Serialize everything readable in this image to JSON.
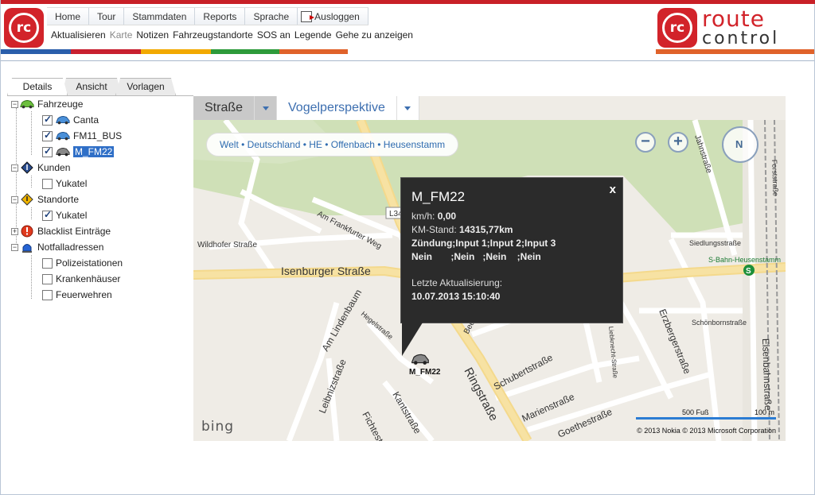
{
  "header": {
    "menu": [
      "Home",
      "Tour",
      "Stammdaten",
      "Reports",
      "Sprache",
      "Ausloggen"
    ],
    "toolbar": [
      "Aktualisieren",
      "Karte",
      "Notizen",
      "Fahrzeugstandorte",
      "SOS an",
      "Legende",
      "Gehe zu anzeigen"
    ],
    "logo_text_line1": "route",
    "logo_text_line2": "control",
    "logo_mark": "rc"
  },
  "left_panel": {
    "tabs": [
      "Details",
      "Ansicht",
      "Vorlagen"
    ],
    "tree": [
      {
        "label": "Fahrzeuge",
        "icon": "car-icon",
        "expanded": true,
        "children": [
          {
            "label": "Canta",
            "checked": true,
            "icon": "car-icon"
          },
          {
            "label": "FM11_BUS",
            "checked": true,
            "icon": "car-icon"
          },
          {
            "label": "M_FM22",
            "checked": true,
            "icon": "car-icon",
            "selected": true
          }
        ]
      },
      {
        "label": "Kunden",
        "icon": "diamond-icon",
        "expanded": true,
        "children": [
          {
            "label": "Yukatel",
            "checked": false
          }
        ]
      },
      {
        "label": "Standorte",
        "icon": "warning-diamond-icon",
        "expanded": true,
        "children": [
          {
            "label": "Yukatel",
            "checked": true
          }
        ]
      },
      {
        "label": "Blacklist Einträge",
        "icon": "alert-icon",
        "expanded": false,
        "children": []
      },
      {
        "label": "Notfalladressen",
        "icon": "siren-icon",
        "expanded": true,
        "children": [
          {
            "label": "Polizeistationen",
            "checked": false
          },
          {
            "label": "Krankenhäuser",
            "checked": false
          },
          {
            "label": "Feuerwehren",
            "checked": false
          }
        ]
      }
    ]
  },
  "map": {
    "tabs": [
      "Straße",
      "Vogelperspektive"
    ],
    "breadcrumb": "Welt • Deutschland • HE • Offenbach • Heusenstamm",
    "street_labels": [
      "Isenburger Straße",
      "Ringstraße",
      "Am Frankfurter Weg",
      "Wildhofer Straße",
      "Am Lindenbaum",
      "Hegelstraße",
      "Leibnizstraße",
      "Kantstraße",
      "Fichtestraße",
      "Schubertstraße",
      "Marienstraße",
      "Beethovenstraße",
      "Erzbergerstraße",
      "Eisenbahnstraße",
      "Jahnstraße",
      "Forststraße",
      "Siedlungsstraße",
      "Schönbornstraße",
      "S-Bahn-Heusenstamm",
      "Goethestraße",
      "Liebknecht-Straße",
      "L3405"
    ],
    "popup": {
      "title": "M_FM22",
      "speed_label": "km/h:",
      "speed_value": "0,00",
      "km_label": "KM-Stand:",
      "km_value": "14315,77km",
      "inputs_header": "Zündung;Input 1;Input 2;Input 3",
      "inputs_values": "Nein       ;Nein   ;Nein    ;Nein",
      "updated_label": "Letzte Aktualisierung:",
      "updated_value": "10.07.2013 15:10:40",
      "close": "x"
    },
    "marker_label": "M_FM22",
    "compass_label": "N",
    "bing": "bing",
    "copyright": "© 2013 Nokia  © 2013 Microsoft Corporation",
    "scale_left": "500 Fuß",
    "scale_right": "100 m"
  },
  "colors": {
    "brand_red": "#d2232a",
    "stripe": [
      "#2a5eab",
      "#c8202f",
      "#f2a900",
      "#2d9a3a",
      "#e0622a"
    ]
  }
}
